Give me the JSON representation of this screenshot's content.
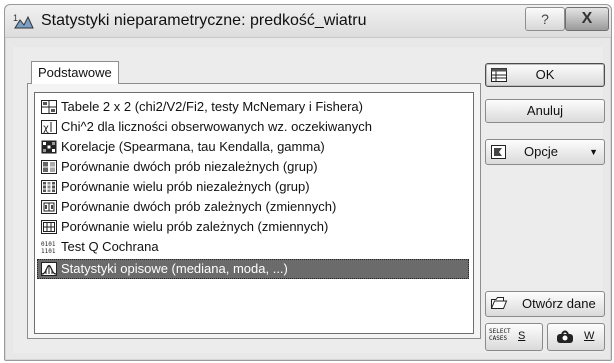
{
  "window": {
    "title": "Statystyki nieparametryczne: predkość_wiatru",
    "help_label": "?",
    "close_label": "X"
  },
  "tab": {
    "label": "Podstawowe"
  },
  "list": {
    "items": [
      {
        "label": "Tabele 2 x 2 (chi2/V2/Fi2, testy McNemary i Fishera)",
        "icon": "table-2x2-icon"
      },
      {
        "label": "Chi^2 dla liczności obserwowanych wz. oczekiwanych",
        "icon": "chi-square-icon"
      },
      {
        "label": "Korelacje (Spearmana, tau Kendalla, gamma)",
        "icon": "correlation-icon"
      },
      {
        "label": "Porównanie dwóch prób niezależnych (grup)",
        "icon": "two-groups-icon"
      },
      {
        "label": "Porównanie wielu prób niezależnych (grup)",
        "icon": "multiple-groups-icon"
      },
      {
        "label": "Porównanie dwóch prób zależnych (zmiennych)",
        "icon": "two-variables-icon"
      },
      {
        "label": "Porównanie wielu prób zależnych (zmiennych)",
        "icon": "multiple-variables-icon"
      },
      {
        "label": "Test Q Cochrana",
        "icon": "cochran-q-icon"
      },
      {
        "label": "Statystyki opisowe (mediana, moda, ...)",
        "icon": "descriptive-stats-icon",
        "selected": true
      }
    ]
  },
  "buttons": {
    "ok": "OK",
    "cancel": "Anuluj",
    "options": "Opcje",
    "open_data": "Otwórz dane",
    "open_data_mnemonic": "t",
    "select_cases_icon_text": "SELECT CASES",
    "select_cases_label": "S",
    "weights_label": "W"
  },
  "colors": {
    "selection": "#6b6b6b",
    "window_bg": "#e8e8e8"
  }
}
